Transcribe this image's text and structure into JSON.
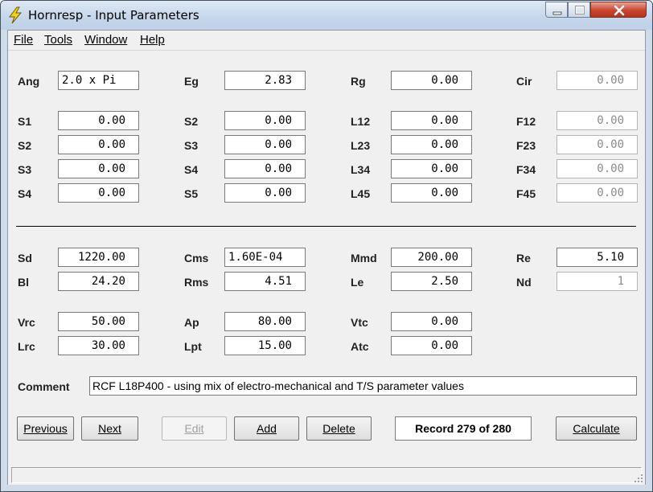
{
  "window": {
    "title": "Hornresp - Input Parameters"
  },
  "menu": {
    "file": "File",
    "tools": "Tools",
    "window": "Window",
    "help": "Help"
  },
  "params": {
    "ang": {
      "label": "Ang",
      "value": "2.0 x Pi"
    },
    "eg": {
      "label": "Eg",
      "value": "2.83"
    },
    "rg": {
      "label": "Rg",
      "value": "0.00"
    },
    "cir": {
      "label": "Cir",
      "value": "0.00"
    },
    "s1": {
      "label": "S1",
      "value": "0.00"
    },
    "s2a": {
      "label": "S2",
      "value": "0.00"
    },
    "s3a": {
      "label": "S3",
      "value": "0.00"
    },
    "s4a": {
      "label": "S4",
      "value": "0.00"
    },
    "s2b": {
      "label": "S2",
      "value": "0.00"
    },
    "s3b": {
      "label": "S3",
      "value": "0.00"
    },
    "s4b": {
      "label": "S4",
      "value": "0.00"
    },
    "s5": {
      "label": "S5",
      "value": "0.00"
    },
    "l12": {
      "label": "L12",
      "value": "0.00"
    },
    "l23": {
      "label": "L23",
      "value": "0.00"
    },
    "l34": {
      "label": "L34",
      "value": "0.00"
    },
    "l45": {
      "label": "L45",
      "value": "0.00"
    },
    "f12": {
      "label": "F12",
      "value": "0.00"
    },
    "f23": {
      "label": "F23",
      "value": "0.00"
    },
    "f34": {
      "label": "F34",
      "value": "0.00"
    },
    "f45": {
      "label": "F45",
      "value": "0.00"
    },
    "sd": {
      "label": "Sd",
      "value": "1220.00"
    },
    "bl": {
      "label": "Bl",
      "value": "24.20"
    },
    "cms": {
      "label": "Cms",
      "value": "1.60E-04"
    },
    "rms": {
      "label": "Rms",
      "value": "4.51"
    },
    "mmd": {
      "label": "Mmd",
      "value": "200.00"
    },
    "le": {
      "label": "Le",
      "value": "2.50"
    },
    "re": {
      "label": "Re",
      "value": "5.10"
    },
    "nd": {
      "label": "Nd",
      "value": "1"
    },
    "vrc": {
      "label": "Vrc",
      "value": "50.00"
    },
    "lrc": {
      "label": "Lrc",
      "value": "30.00"
    },
    "ap": {
      "label": "Ap",
      "value": "80.00"
    },
    "lpt": {
      "label": "Lpt",
      "value": "15.00"
    },
    "vtc": {
      "label": "Vtc",
      "value": "0.00"
    },
    "atc": {
      "label": "Atc",
      "value": "0.00"
    }
  },
  "comment": {
    "label": "Comment",
    "value": "RCF L18P400 - using mix of electro-mechanical and T/S parameter values"
  },
  "buttons": {
    "previous": "Previous",
    "next": "Next",
    "edit": "Edit",
    "add": "Add",
    "delete": "Delete",
    "calculate": "Calculate"
  },
  "record": "Record 279 of 280",
  "colors": {
    "title_bar": "#c5d6ea",
    "close_button": "#c9452d",
    "form_bg": "#f0f0f0",
    "disabled_text": "#8c8c8c"
  }
}
